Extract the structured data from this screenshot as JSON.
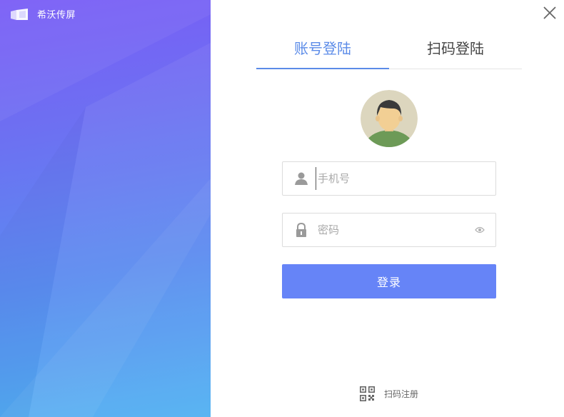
{
  "app": {
    "name": "希沃传屏"
  },
  "tabs": [
    {
      "label": "账号登陆",
      "active": true
    },
    {
      "label": "扫码登陆",
      "active": false
    }
  ],
  "form": {
    "phone_placeholder": "手机号",
    "password_placeholder": "密码",
    "login_label": "登录"
  },
  "footer": {
    "register_label": "扫码注册"
  },
  "colors": {
    "accent": "#5b8be8",
    "button": "#6684f7",
    "gradient_top": "#7a5cf6",
    "gradient_bottom": "#4fb1f2"
  },
  "icons": [
    "app-logo-icon",
    "close-icon",
    "user-icon",
    "lock-icon",
    "eye-icon",
    "qr-code-icon"
  ]
}
